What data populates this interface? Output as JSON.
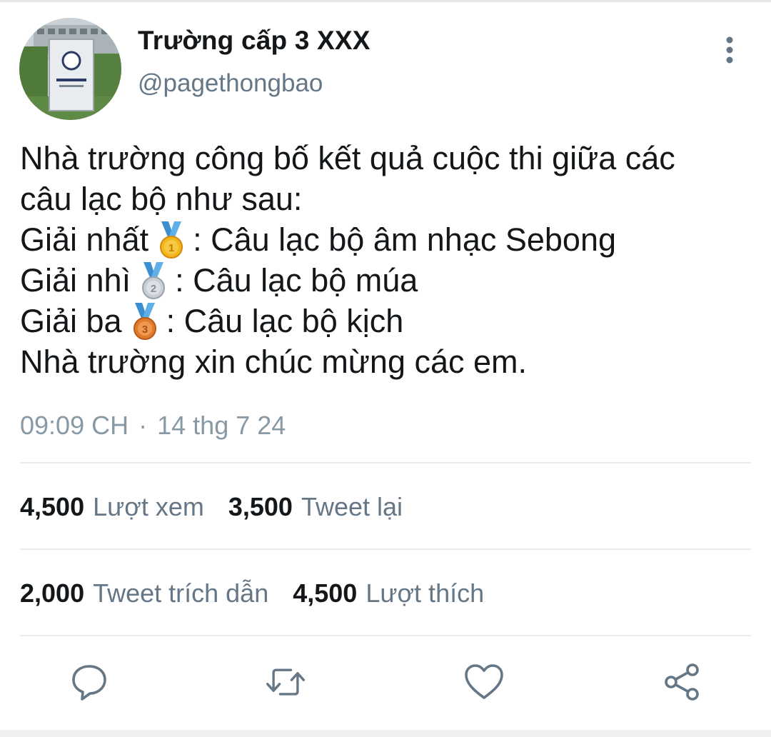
{
  "author": {
    "display_name": "Trường cấp 3 XXX",
    "handle": "@pagethongbao"
  },
  "tweet": {
    "line1": "Nhà trường công bố kết quả cuộc thi giữa các",
    "line2": "câu lạc bộ như sau:",
    "first_prize_label": "Giải nhất",
    "first_prize_text": ": Câu lạc bộ âm nhạc Sebong",
    "second_prize_label": "Giải nhì",
    "second_prize_text": ": Câu lạc bộ múa",
    "third_prize_label": "Giải ba",
    "third_prize_text": ": Câu lạc bộ kịch",
    "closing_line": "Nhà trường xin chúc mừng các em."
  },
  "meta": {
    "time": "09:09 CH",
    "separator": "·",
    "date": "14 thg 7 24"
  },
  "stats": {
    "views_count": "4,500",
    "views_label": "Lượt xem",
    "retweets_count": "3,500",
    "retweets_label": "Tweet lại",
    "quotes_count": "2,000",
    "quotes_label": "Tweet trích dẫn",
    "likes_count": "4,500",
    "likes_label": "Lượt thích"
  },
  "icons": {
    "more": "more-vertical-icon",
    "reply": "reply-icon",
    "retweet": "retweet-icon",
    "like": "heart-icon",
    "share": "share-icon",
    "medals": [
      "gold-medal-icon",
      "silver-medal-icon",
      "bronze-medal-icon"
    ]
  },
  "colors": {
    "text_primary": "#14171a",
    "text_secondary": "#657786",
    "icon_gray": "#657786",
    "divider": "#e6ecf0"
  }
}
